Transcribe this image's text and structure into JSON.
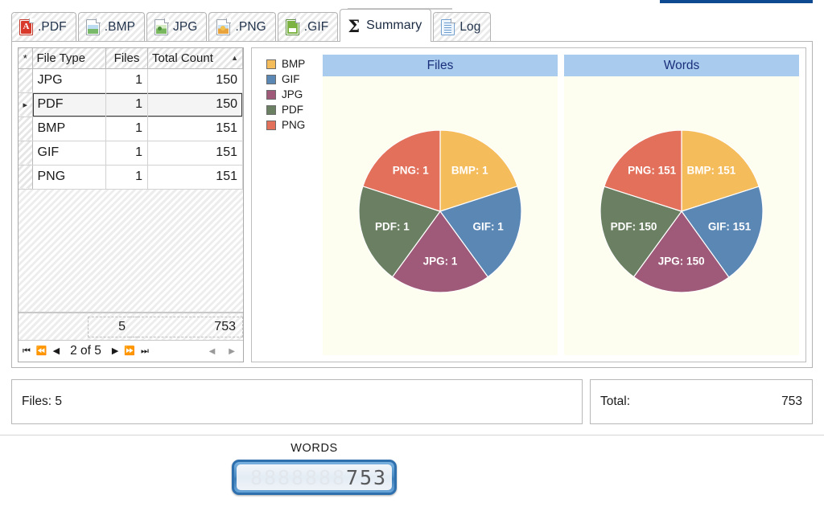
{
  "window": {
    "accent_color": "#0d4a8f"
  },
  "tabs": [
    {
      "label": ".PDF",
      "icon": "pdf-file-icon",
      "active": false
    },
    {
      "label": ".BMP",
      "icon": "bmp-file-icon",
      "active": false
    },
    {
      "label": "JPG",
      "icon": "jpg-file-icon",
      "active": false
    },
    {
      "label": ".PNG",
      "icon": "png-file-icon",
      "active": false
    },
    {
      "label": ".GIF",
      "icon": "gif-file-icon",
      "active": false
    },
    {
      "label": "Summary",
      "icon": "sigma-icon",
      "active": true
    },
    {
      "label": "Log",
      "icon": "log-file-icon",
      "active": false
    }
  ],
  "grid": {
    "row_header_glyph": "*",
    "current_row_glyph": "▸",
    "columns": [
      {
        "key": "type",
        "label": "File Type"
      },
      {
        "key": "files",
        "label": "Files"
      },
      {
        "key": "total",
        "label": "Total Count",
        "sorted": "ascending",
        "sort_glyph": "▲"
      }
    ],
    "rows": [
      {
        "type": "JPG",
        "files": "1",
        "total": "150",
        "current": false
      },
      {
        "type": "PDF",
        "files": "1",
        "total": "150",
        "current": true
      },
      {
        "type": "BMP",
        "files": "1",
        "total": "151",
        "current": false
      },
      {
        "type": "GIF",
        "files": "1",
        "total": "151",
        "current": false
      },
      {
        "type": "PNG",
        "files": "1",
        "total": "151",
        "current": false
      }
    ],
    "summary": {
      "files": "5",
      "total": "753"
    },
    "navigator": {
      "first_glyph": "⏮",
      "prev_page_glyph": "⏪",
      "prev_glyph": "◀",
      "position": "2 of 5",
      "next_glyph": "▶",
      "next_page_glyph": "⏩",
      "last_glyph": "⏭",
      "scroll_left_glyph": "◀",
      "scroll_right_glyph": "▶"
    }
  },
  "legend": {
    "items": [
      {
        "label": "BMP",
        "color": "#f5bc5c"
      },
      {
        "label": "GIF",
        "color": "#5b87b5"
      },
      {
        "label": "JPG",
        "color": "#9e5a78"
      },
      {
        "label": "PDF",
        "color": "#6b8063"
      },
      {
        "label": "PNG",
        "color": "#e2705a"
      }
    ]
  },
  "chart_data": [
    {
      "type": "pie",
      "title": "Files",
      "categories": [
        "BMP",
        "GIF",
        "JPG",
        "PDF",
        "PNG"
      ],
      "values": [
        1,
        1,
        1,
        1,
        1
      ],
      "labels": [
        "BMP: 1",
        "GIF: 1",
        "JPG: 1",
        "PDF: 1",
        "PNG: 1"
      ],
      "colors": [
        "#f5bc5c",
        "#5b87b5",
        "#9e5a78",
        "#6b8063",
        "#e2705a"
      ],
      "total": 5,
      "start_angle_deg": 0,
      "direction": "clockwise",
      "legend_position": "left",
      "plot_background": "#fdfdf0"
    },
    {
      "type": "pie",
      "title": "Words",
      "categories": [
        "BMP",
        "GIF",
        "JPG",
        "PDF",
        "PNG"
      ],
      "values": [
        151,
        151,
        150,
        150,
        151
      ],
      "labels": [
        "BMP: 151",
        "GIF: 151",
        "JPG: 150",
        "PDF: 150",
        "PNG: 151"
      ],
      "colors": [
        "#f5bc5c",
        "#5b87b5",
        "#9e5a78",
        "#6b8063",
        "#e2705a"
      ],
      "total": 753,
      "start_angle_deg": 0,
      "direction": "clockwise",
      "legend_position": "left",
      "plot_background": "#fdfdf0"
    }
  ],
  "status": {
    "files_label": "Files: 5",
    "total_label": "Total:",
    "total_value": "753"
  },
  "led": {
    "caption": "WORDS",
    "value": "753",
    "digit_count": 10,
    "off_glyph": "8"
  }
}
